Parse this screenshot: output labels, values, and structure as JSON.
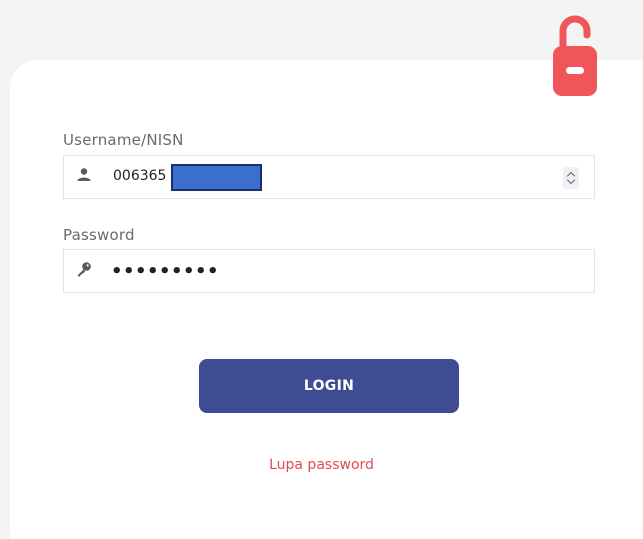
{
  "form": {
    "username_label": "Username/NISN",
    "username_value": "006365",
    "password_label": "Password",
    "password_value": "•••••••••",
    "login_label": "LOGIN",
    "forgot_label": "Lupa password"
  },
  "icons": {
    "lock": "unlocked-padlock-icon",
    "user": "user-icon",
    "key": "key-icon",
    "stepper": "stepper-icon"
  },
  "colors": {
    "lock": "#f0555a",
    "button": "#3f4b93",
    "link": "#e54a4f",
    "label": "#666a73"
  }
}
